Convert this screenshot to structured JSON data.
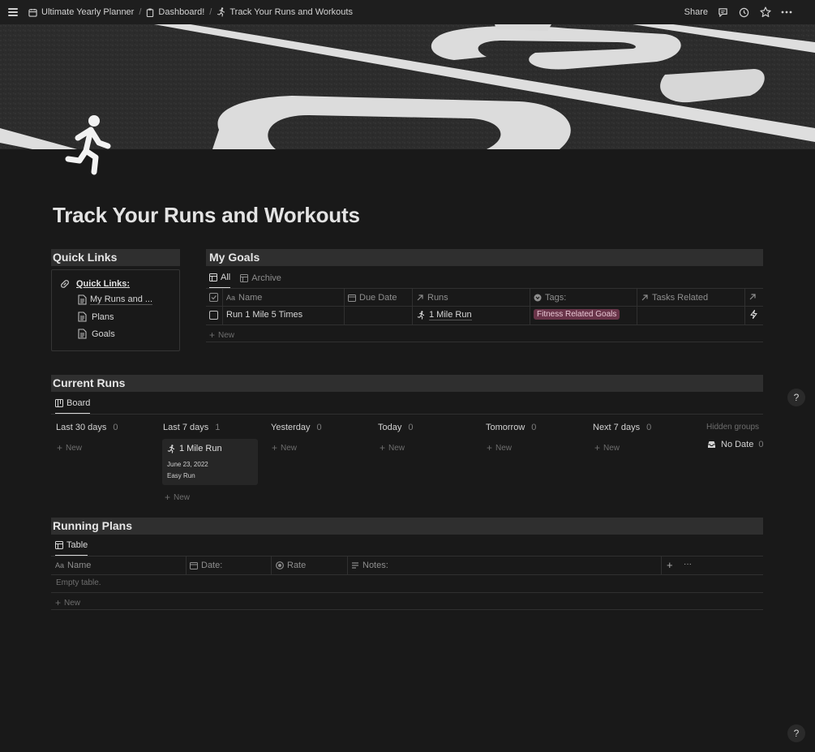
{
  "breadcrumb": {
    "items": [
      {
        "label": "Ultimate Yearly Planner"
      },
      {
        "label": "Dashboard!"
      },
      {
        "label": "Track Your Runs and Workouts"
      }
    ],
    "separator": "/"
  },
  "topbar": {
    "share_label": "Share"
  },
  "page": {
    "title": "Track Your Runs and Workouts"
  },
  "quick_links": {
    "header": "Quick Links",
    "heading_link": "Quick Links:",
    "items": [
      {
        "label": "My Runs and ..."
      },
      {
        "label": "Plans"
      },
      {
        "label": "Goals"
      }
    ]
  },
  "goals": {
    "header": "My Goals",
    "tabs": [
      {
        "label": "All"
      },
      {
        "label": "Archive"
      }
    ],
    "columns": [
      {
        "label": "Name"
      },
      {
        "label": "Due Date"
      },
      {
        "label": "Runs"
      },
      {
        "label": "Tags:"
      },
      {
        "label": "Tasks Related"
      }
    ],
    "rows": [
      {
        "name": "Run 1 Mile 5 Times",
        "due_date": "",
        "runs": "1 Mile Run",
        "tag": "Fitness Related Goals",
        "tasks": ""
      }
    ],
    "new_label": "New"
  },
  "current_runs": {
    "header": "Current Runs",
    "tab": "Board",
    "columns": [
      {
        "label": "Last 30 days",
        "count": "0"
      },
      {
        "label": "Last 7 days",
        "count": "1"
      },
      {
        "label": "Yesterday",
        "count": "0"
      },
      {
        "label": "Today",
        "count": "0"
      },
      {
        "label": "Tomorrow",
        "count": "0"
      },
      {
        "label": "Next 7 days",
        "count": "0"
      }
    ],
    "hidden_groups_label": "Hidden groups",
    "hidden_groups": [
      {
        "label": "No Date",
        "count": "0"
      }
    ],
    "card": {
      "title": "1 Mile Run",
      "date": "June 23, 2022",
      "type": "Easy Run"
    },
    "new_label": "New"
  },
  "running_plans": {
    "header": "Running Plans",
    "tab": "Table",
    "columns": [
      {
        "label": "Name"
      },
      {
        "label": "Date:"
      },
      {
        "label": "Rate"
      },
      {
        "label": "Notes:"
      }
    ],
    "add_symbol": "+",
    "more_symbol": "···",
    "empty_text": "Empty table.",
    "new_label": "New"
  },
  "help": {
    "label": "?"
  },
  "colors": {
    "background": "#191919",
    "header_bg": "#2f2f2f",
    "tag_bg": "#693449"
  }
}
